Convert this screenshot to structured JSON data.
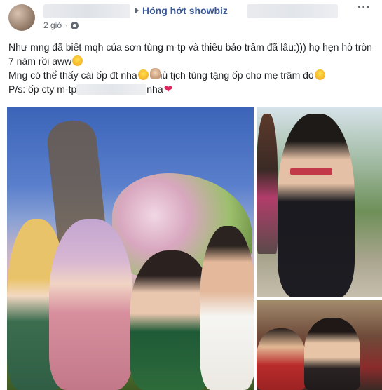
{
  "header": {
    "group_name": "Hóng hớt showbiz",
    "time": "2 giờ",
    "more_label": "···"
  },
  "post": {
    "line1": "Như mng đã biết mqh của sơn tùng m-tp và thiều bảo trâm đã lâu:))) họ hẹn hò tròn 7 năm rồi aww",
    "line2_a": "Mng có thể thấy cái ốp đt nha",
    "line2_b": " chủ tịch tùng tặng ốp cho mẹ trâm đó",
    "line3_a": "P/s: ốp cty m-tp",
    "line3_b": "nha",
    "heart": "❤"
  },
  "photos": [
    {
      "name": "main-photo",
      "kind": "group photo in front of flowers"
    },
    {
      "name": "side-photo-top",
      "kind": "woman in black"
    },
    {
      "name": "side-photo-bottom",
      "kind": "women at table"
    }
  ],
  "colors": {
    "link": "#385898",
    "text": "#1c1e21",
    "meta": "#606770"
  }
}
